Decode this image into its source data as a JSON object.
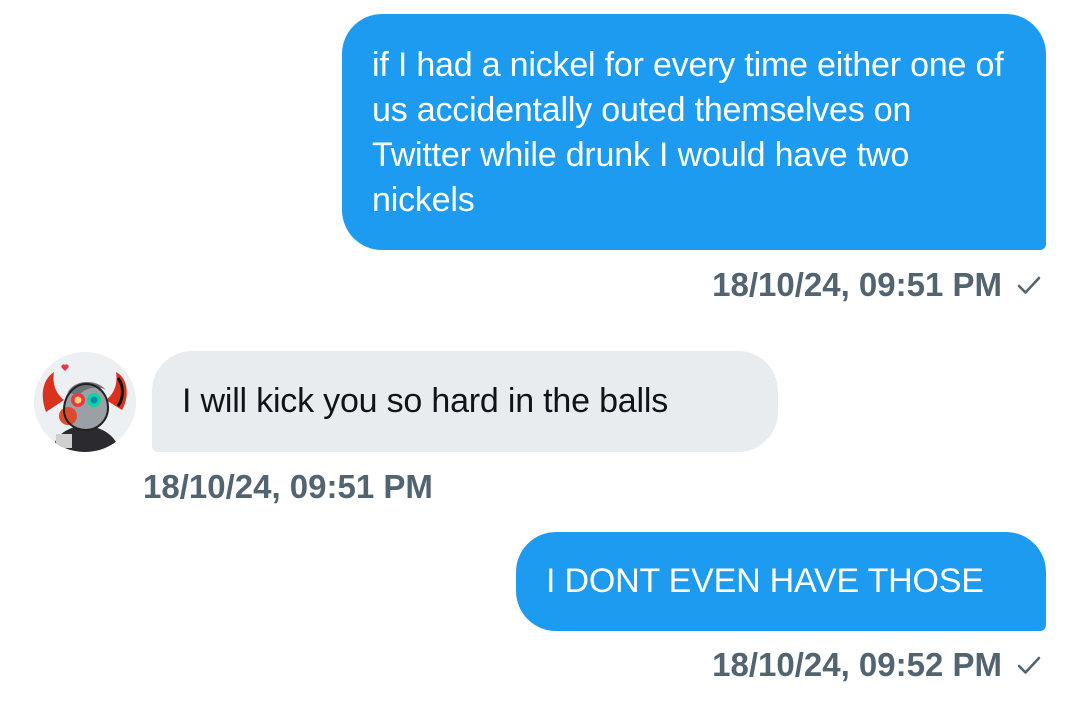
{
  "messages": [
    {
      "direction": "sent",
      "text": "if I had a nickel for every time either one of us accidentally outed themselves on Twitter while drunk I would have two nickels",
      "timestamp": "18/10/24, 09:51 PM",
      "status_icon": "check-icon"
    },
    {
      "direction": "received",
      "text": "I will kick you so hard in the balls",
      "timestamp": "18/10/24, 09:51 PM",
      "avatar_icon": "user-avatar"
    },
    {
      "direction": "sent",
      "text": "I DONT EVEN HAVE THOSE",
      "timestamp": "18/10/24, 09:52 PM",
      "status_icon": "check-icon"
    }
  ],
  "colors": {
    "sent_bubble": "#1d9bf0",
    "received_bubble": "#e9ecef",
    "timestamp": "#536471",
    "received_text": "#0f1419"
  }
}
